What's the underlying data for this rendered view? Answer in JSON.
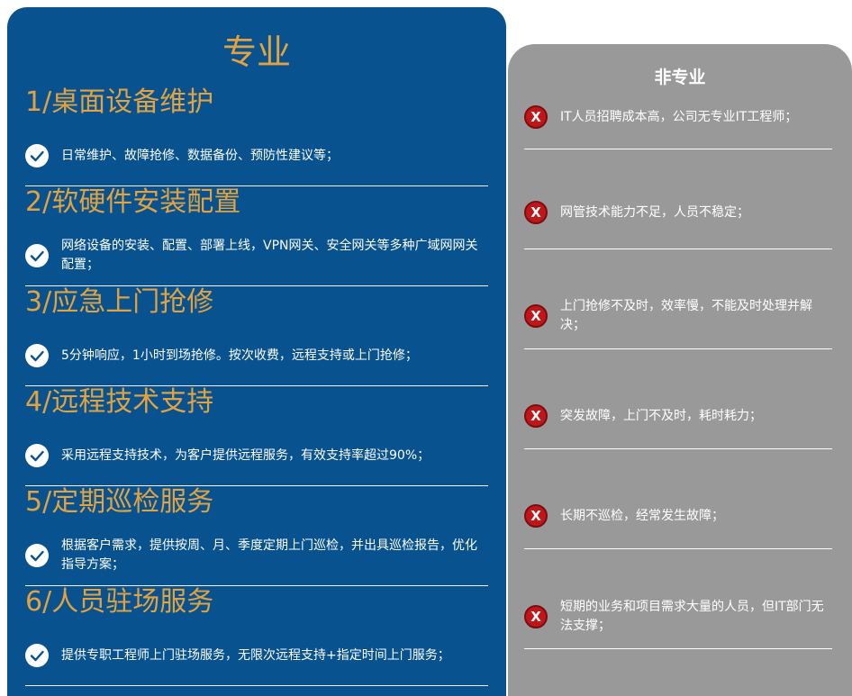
{
  "professional": {
    "title": "专业",
    "items": [
      {
        "heading": "1/桌面设备维护",
        "text": "日常维护、故障抢修、数据备份、预防性建议等；"
      },
      {
        "heading": "2/软硬件安装配置",
        "text": "网络设备的安装、配置、部署上线，VPN网关、安全网关等多种广域网网关配置；"
      },
      {
        "heading": "3/应急上门抢修",
        "text": "5分钟响应，1小时到场抢修。按次收费，远程支持或上门抢修；"
      },
      {
        "heading": "4/远程技术支持",
        "text": "采用远程支持技术，为客户提供远程服务，有效支持率超过90%；"
      },
      {
        "heading": "5/定期巡检服务",
        "text": "根据客户需求，提供按周、月、季度定期上门巡检，并出具巡检报告，优化指导方案；"
      },
      {
        "heading": "6/人员驻场服务",
        "text": "提供专职工程师上门驻场服务，无限次远程支持+指定时间上门服务；"
      }
    ]
  },
  "non_professional": {
    "title": "非专业",
    "items": [
      {
        "text": "IT人员招聘成本高，公司无专业IT工程师；"
      },
      {
        "text": "网管技术能力不足，人员不稳定；"
      },
      {
        "text": "上门抢修不及时，效率慢，不能及时处理并解决；"
      },
      {
        "text": "突发故障，上门不及时，耗时耗力；"
      },
      {
        "text": "长期不巡检，经常发生故障；"
      },
      {
        "text": "短期的业务和项目需求大量的人员，但IT部门无法支撑；"
      }
    ]
  },
  "icons": {
    "check": "check-circle-icon",
    "cross": "x-circle-icon",
    "cross_glyph": "X"
  },
  "colors": {
    "pro_bg": "#07528f",
    "accent": "#e2a23f",
    "non_bg": "#999999",
    "cross": "#c0161a"
  }
}
